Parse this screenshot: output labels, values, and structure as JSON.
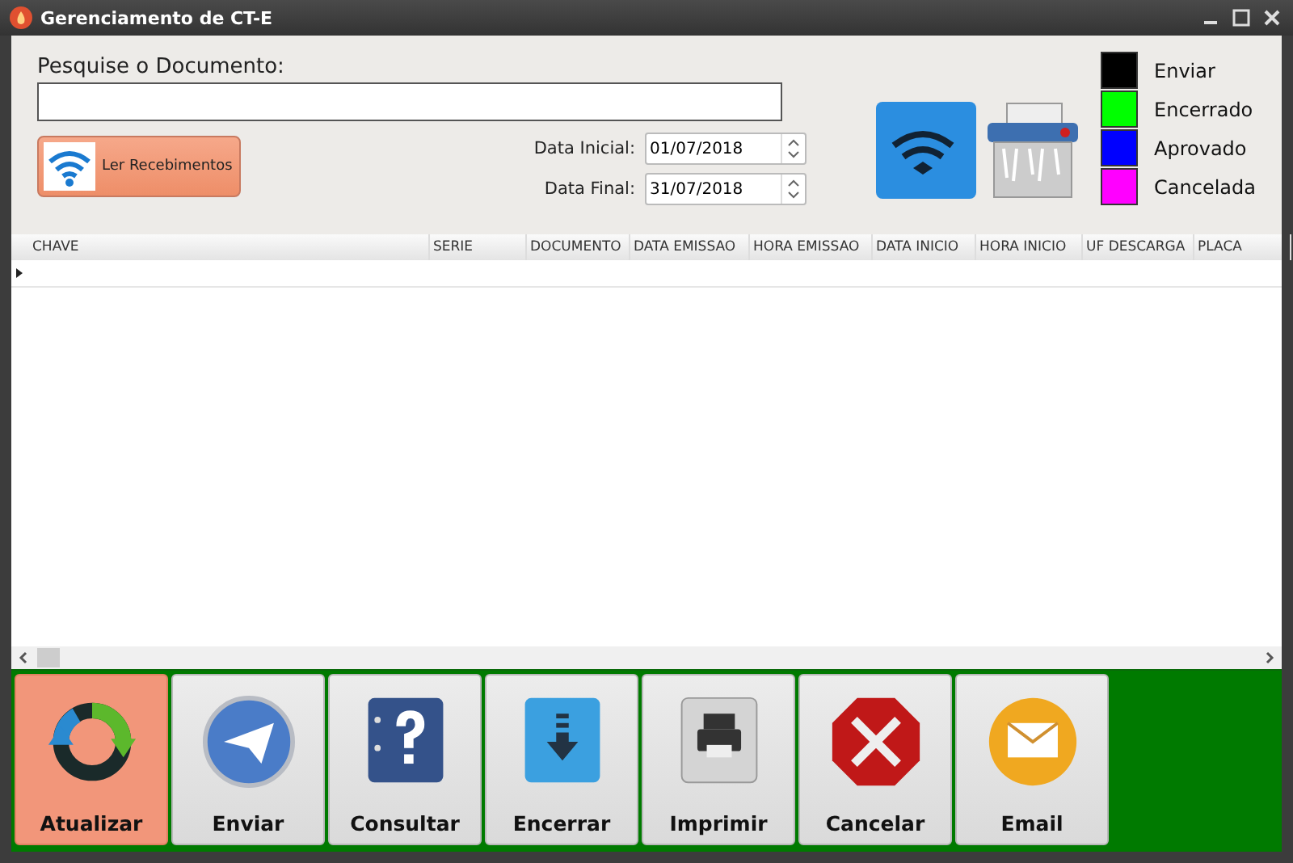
{
  "window": {
    "title": "Gerenciamento de CT-E"
  },
  "search": {
    "label": "Pesquise o Documento:"
  },
  "read_button": {
    "label": "Ler Recebimentos"
  },
  "dates": [
    {
      "label": "Data Inicial:",
      "value": "01/07/2018"
    },
    {
      "label": "Data Final:",
      "value": "31/07/2018"
    }
  ],
  "legend": [
    {
      "label": "Enviar",
      "color": "#000000"
    },
    {
      "label": "Encerrado",
      "color": "#00ff00"
    },
    {
      "label": "Aprovado",
      "color": "#0000ff"
    },
    {
      "label": "Cancelada",
      "color": "#ff00ff"
    }
  ],
  "table": {
    "columns": [
      "CHAVE",
      "SERIE",
      "DOCUMENTO",
      "DATA EMISSAO",
      "HORA EMISSAO",
      "DATA INICIO",
      "HORA INICIO",
      "UF DESCARGA",
      "PLACA"
    ]
  },
  "actions": [
    {
      "label": "Atualizar",
      "kind": "refresh",
      "selected": true
    },
    {
      "label": "Enviar",
      "kind": "send",
      "selected": false
    },
    {
      "label": "Consultar",
      "kind": "query",
      "selected": false
    },
    {
      "label": "Encerrar",
      "kind": "close",
      "selected": false
    },
    {
      "label": "Imprimir",
      "kind": "print",
      "selected": false
    },
    {
      "label": "Cancelar",
      "kind": "cancel",
      "selected": false
    },
    {
      "label": "Email",
      "kind": "email",
      "selected": false
    }
  ]
}
